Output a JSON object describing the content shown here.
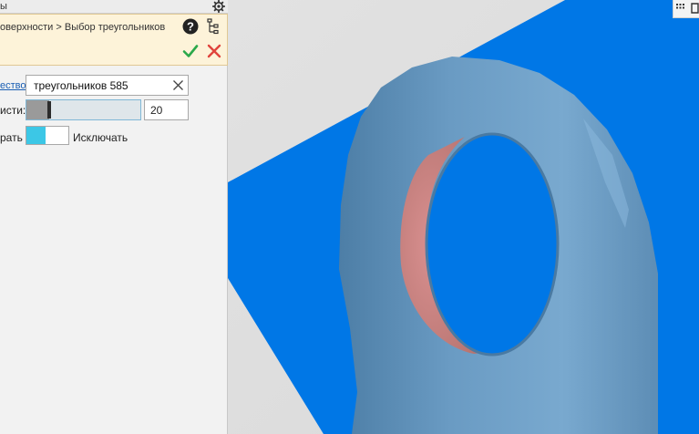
{
  "panel": {
    "title": "ы",
    "breadcrumb": "оверхности > Выбор треугольников",
    "method_link": "ество",
    "triangle_count": "треугольников 585",
    "smoothness_label": "исти:",
    "smoothness_value": "20",
    "smoothness_level": 0.2,
    "select_label": "рать",
    "exclude_label": "Исключать"
  },
  "icons": {
    "settings": "gear-icon",
    "help": "help-icon",
    "tree": "tree-icon",
    "ok": "check-icon",
    "cancel": "close-icon",
    "clear": "clear-icon",
    "grid": "grid-icon",
    "frame": "frame-icon"
  },
  "colors": {
    "accent_blue": "#0077e6",
    "model": "#5f8fb4",
    "selection": "#d98f8f",
    "command_bg": "#fdf3d9",
    "ok_green": "#2aa84a",
    "cancel_red": "#e0443c",
    "toggle_on": "#3cc7e6"
  }
}
